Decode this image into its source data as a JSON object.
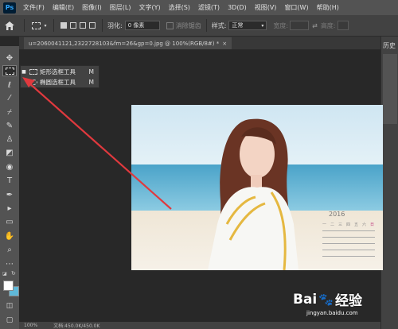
{
  "menubar": {
    "logo": "Ps",
    "items": [
      "文件(F)",
      "编辑(E)",
      "图像(I)",
      "图层(L)",
      "文字(Y)",
      "选择(S)",
      "滤镜(T)",
      "3D(D)",
      "视图(V)",
      "窗口(W)",
      "帮助(H)"
    ]
  },
  "options": {
    "feather_label": "羽化:",
    "feather_value": "0 像素",
    "antialias_label": "消除锯齿",
    "style_label": "样式:",
    "style_value": "正常",
    "width_label": "宽度:",
    "height_label": "高度:"
  },
  "document": {
    "tab_title": "u=2060041121,2322728103&fm=26&gp=0.jpg @ 100%(RGB/8#) *"
  },
  "flyout": {
    "items": [
      {
        "label": "矩形选框工具",
        "key": "M",
        "selected": true
      },
      {
        "label": "椭圆选框工具",
        "key": "M",
        "selected": false
      }
    ]
  },
  "right_panel": {
    "tab": "历史"
  },
  "statusbar": {
    "zoom": "100%",
    "doc": "文档:450.0K/450.0K"
  },
  "image": {
    "calendar_year": "2016",
    "calendar_weekdays": [
      "一",
      "二",
      "三",
      "四",
      "五",
      "六",
      "日"
    ]
  },
  "watermark": {
    "brand": "Bai",
    "brand_suffix": "经验",
    "url": "jingyan.baidu.com"
  },
  "colors": {
    "foreground": "#ffffff",
    "background": "#5fb8d8",
    "annotation_arrow": "#e0393e"
  }
}
